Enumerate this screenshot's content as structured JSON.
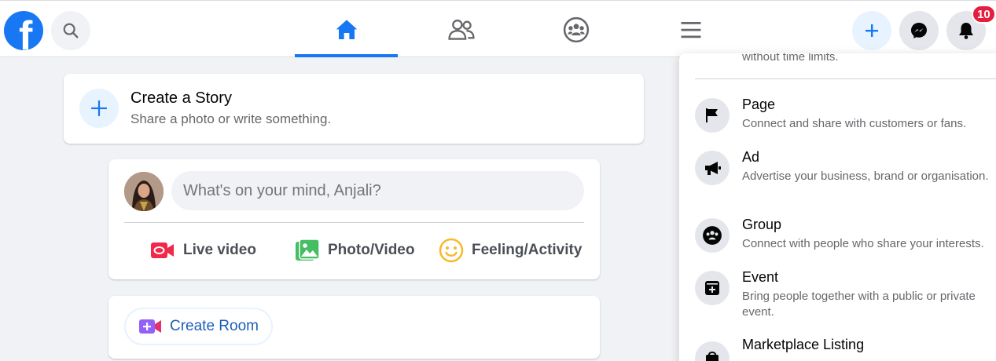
{
  "colors": {
    "brand": "#1877f2",
    "badge": "#e41e3f",
    "live": "#f02849",
    "photo": "#45bd62",
    "feeling": "#f7b928",
    "room": "#9360f7"
  },
  "topbar": {
    "logo_icon": "facebook-logo",
    "search_icon": "search-icon",
    "nav": [
      {
        "name": "home",
        "icon": "home-icon",
        "active": true
      },
      {
        "name": "friends",
        "icon": "friends-icon",
        "active": false
      },
      {
        "name": "groups",
        "icon": "groups-icon",
        "active": false
      },
      {
        "name": "menu",
        "icon": "hamburger-icon",
        "active": false
      }
    ],
    "notifications_badge": "10"
  },
  "story": {
    "title": "Create a Story",
    "subtitle": "Share a photo or write something."
  },
  "composer": {
    "placeholder": "What's on your mind, Anjali?",
    "actions": [
      {
        "label": "Live video",
        "icon": "live-video-icon"
      },
      {
        "label": "Photo/Video",
        "icon": "photo-icon"
      },
      {
        "label": "Feeling/Activity",
        "icon": "smiley-icon"
      }
    ]
  },
  "room": {
    "label": "Create Room"
  },
  "create_menu": {
    "partial_text": "without time limits.",
    "items": [
      {
        "title": "Page",
        "desc": "Connect and share with customers or fans.",
        "icon": "flag-icon"
      },
      {
        "title": "Ad",
        "desc": "Advertise your business, brand or organisation.",
        "icon": "megaphone-icon"
      },
      {
        "title": "Group",
        "desc": "Connect with people who share your interests.",
        "icon": "group-icon"
      },
      {
        "title": "Event",
        "desc": "Bring people together with a public or private event.",
        "icon": "calendar-plus-icon"
      },
      {
        "title": "Marketplace Listing",
        "desc": "",
        "icon": "shopping-bag-icon"
      }
    ]
  }
}
